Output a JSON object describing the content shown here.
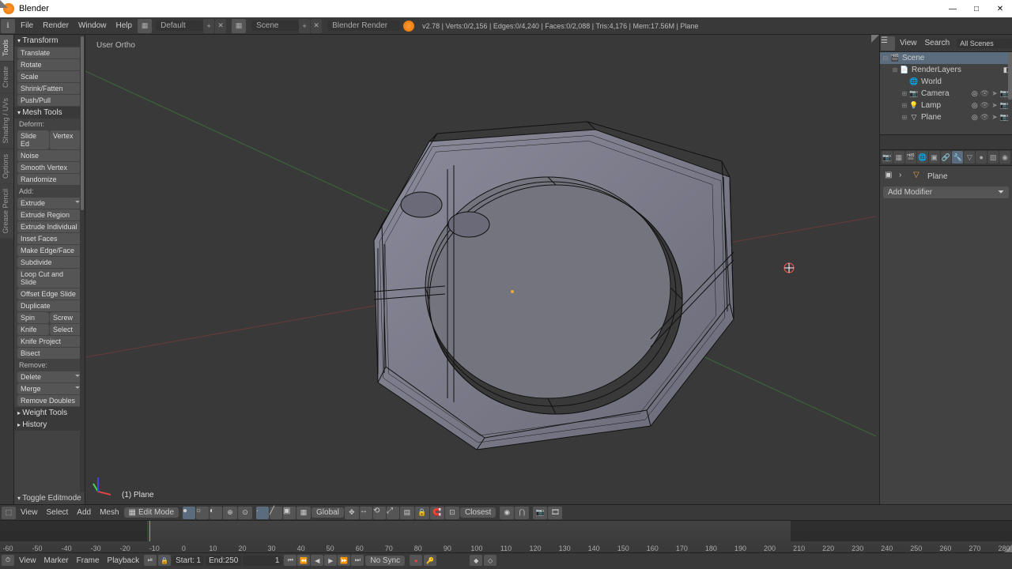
{
  "app": {
    "title": "Blender"
  },
  "window_controls": {
    "min": "—",
    "max": "□",
    "close": "✕"
  },
  "menubar": {
    "items": [
      "File",
      "Render",
      "Window",
      "Help"
    ],
    "layout": "Default",
    "scene": "Scene",
    "engine": "Blender Render",
    "stats": "v2.78 | Verts:0/2,156 | Edges:0/4,240 | Faces:0/2,088 | Tris:4,176 | Mem:17.56M | Plane"
  },
  "left_tabs": [
    "Tools",
    "Create",
    "Shading / UVs",
    "Options",
    "Grease Pencil"
  ],
  "tool_panel": {
    "transform_hdr": "Transform",
    "transform": [
      "Translate",
      "Rotate",
      "Scale",
      "Shrink/Fatten",
      "Push/Pull"
    ],
    "mesh_hdr": "Mesh Tools",
    "deform_label": "Deform:",
    "slide_edge": "Slide Ed",
    "vertex": "Vertex",
    "noise": "Noise",
    "smooth_vtx": "Smooth Vertex",
    "randomize": "Randomize",
    "add_label": "Add:",
    "extrude": "Extrude",
    "extrude_region": "Extrude Region",
    "extrude_indiv": "Extrude Individual",
    "inset": "Inset Faces",
    "make_edge": "Make Edge/Face",
    "subdivide": "Subdivide",
    "loop_cut": "Loop Cut and Slide",
    "offset_edge": "Offset Edge Slide",
    "duplicate": "Duplicate",
    "spin": "Spin",
    "screw": "Screw",
    "knife": "Knife",
    "select": "Select",
    "knife_project": "Knife Project",
    "bisect": "Bisect",
    "remove_label": "Remove:",
    "delete": "Delete",
    "merge": "Merge",
    "remove_doubles": "Remove Doubles",
    "weight_hdr": "Weight Tools",
    "history_hdr": "History",
    "toggle_editmode": "Toggle Editmode"
  },
  "viewport": {
    "projection": "User Ortho",
    "object_label": "(1) Plane"
  },
  "view_header": {
    "menus": [
      "View",
      "Select",
      "Add",
      "Mesh"
    ],
    "mode": "Edit Mode",
    "orientation": "Global",
    "snap_target": "Closest"
  },
  "outliner": {
    "menus": [
      "View",
      "Search"
    ],
    "filter": "All Scenes",
    "rows": [
      {
        "exp": "⊟",
        "icon": "🎬",
        "name": "Scene",
        "indent": 0,
        "sel": true,
        "restrict": false
      },
      {
        "exp": "⊞",
        "icon": "📄",
        "name": "RenderLayers",
        "indent": 1,
        "restrict": false,
        "extra": "◧"
      },
      {
        "exp": "",
        "icon": "🌐",
        "name": "World",
        "indent": 2,
        "restrict": false
      },
      {
        "exp": "⊞",
        "icon": "📷",
        "name": "Camera",
        "indent": 2,
        "restrict": true,
        "extra": "◎"
      },
      {
        "exp": "⊞",
        "icon": "💡",
        "name": "Lamp",
        "indent": 2,
        "restrict": true,
        "extra": "◎"
      },
      {
        "exp": "⊞",
        "icon": "▽",
        "name": "Plane",
        "indent": 2,
        "restrict": true,
        "extra": "◎"
      }
    ]
  },
  "properties": {
    "object_name": "Plane",
    "add_modifier": "Add Modifier"
  },
  "timeline": {
    "menus": [
      "View",
      "Marker",
      "Frame",
      "Playback"
    ],
    "start_label": "Start:",
    "start": "1",
    "end_label": "End:",
    "end": "250",
    "current": "1",
    "sync": "No Sync",
    "ticks": [
      "-60",
      "-50",
      "-40",
      "-30",
      "-20",
      "-10",
      "0",
      "10",
      "20",
      "30",
      "40",
      "50",
      "60",
      "70",
      "80",
      "90",
      "100",
      "110",
      "120",
      "130",
      "140",
      "150",
      "160",
      "170",
      "180",
      "190",
      "200",
      "210",
      "220",
      "230",
      "240",
      "250",
      "260",
      "270",
      "280"
    ]
  }
}
